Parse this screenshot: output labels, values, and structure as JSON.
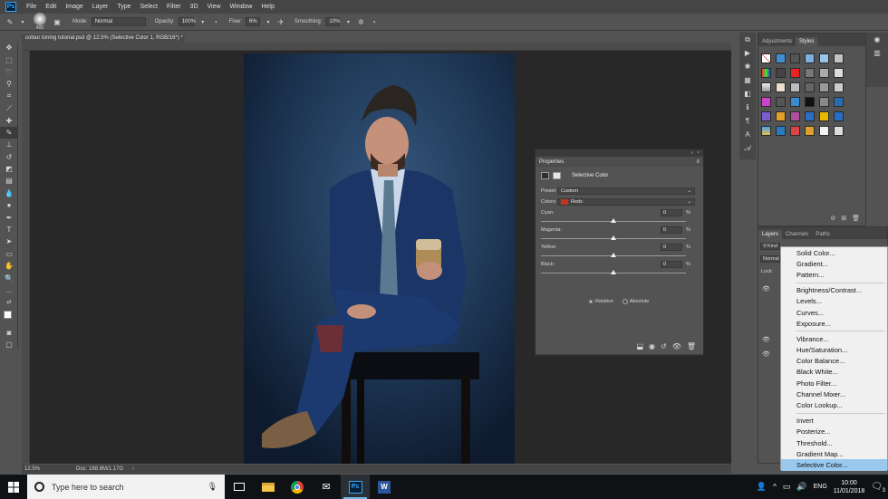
{
  "app": {
    "name": "Adobe Photoshop",
    "logo_text": "Ps"
  },
  "menu": [
    "File",
    "Edit",
    "Image",
    "Layer",
    "Type",
    "Select",
    "Filter",
    "3D",
    "View",
    "Window",
    "Help"
  ],
  "options_bar": {
    "brush_size": "400",
    "mode_label": "Mode:",
    "mode_value": "Normal",
    "opacity_label": "Opacity:",
    "opacity_value": "100%",
    "flow_label": "Flow:",
    "flow_value": "6%",
    "smoothing_label": "Smoothing:",
    "smoothing_value": "10%"
  },
  "document": {
    "tab_title": "colour toning tutorial.psd @ 12.5% (Selective Color 1, RGB/16*) *",
    "zoom": "12.5%",
    "doc_info": "Doc: 188.8M/1.17G"
  },
  "properties": {
    "panel_title": "Properties",
    "adjustment_name": "Selective Color",
    "preset_label": "Preset:",
    "preset_value": "Custom",
    "colors_label": "Colors:",
    "colors_value": "Reds",
    "colors_swatch": "#c8331e",
    "sliders": [
      {
        "label": "Cyan:",
        "value": "0",
        "unit": "%",
        "level": 0.5
      },
      {
        "label": "Magenta:",
        "value": "0",
        "unit": "%",
        "level": 0.5
      },
      {
        "label": "Yellow:",
        "value": "0",
        "unit": "%",
        "level": 0.5
      },
      {
        "label": "Black:",
        "value": "0",
        "unit": "%",
        "level": 0.5
      }
    ],
    "method_relative": "Relative",
    "method_absolute": "Absolute",
    "selected_method": "Relative"
  },
  "styles_panel": {
    "tabs": [
      "Adjustments",
      "Styles"
    ],
    "active_tab": "Styles"
  },
  "layers_panel": {
    "tabs": [
      "Layers",
      "Channels",
      "Paths"
    ],
    "active_tab": "Layers",
    "kind_label": "Kind",
    "blend_mode": "Normal",
    "lock_label": "Lock:"
  },
  "context_menu": {
    "items": [
      "Solid Color...",
      "Gradient...",
      "Pattern...",
      "---",
      "Brightness/Contrast...",
      "Levels...",
      "Curves...",
      "Exposure...",
      "---",
      "Vibrance...",
      "Hue/Saturation...",
      "Color Balance...",
      "Black  White...",
      "Photo Filter...",
      "Channel Mixer...",
      "Color Lookup...",
      "---",
      "Invert",
      "Posterize...",
      "Threshold...",
      "Gradient Map...",
      "Selective Color..."
    ],
    "highlighted": "Selective Color..."
  },
  "taskbar": {
    "search_placeholder": "Type here to search",
    "apps": [
      "task-view",
      "file-explorer",
      "chrome",
      "mail",
      "photoshop",
      "word"
    ],
    "active_app": "photoshop",
    "time": "10:00",
    "date": "11/01/2018",
    "notification_count": "3"
  },
  "accent_colors": {
    "photoshop_blue": "#31a8ff",
    "menu_highlight": "#99c9ef"
  }
}
